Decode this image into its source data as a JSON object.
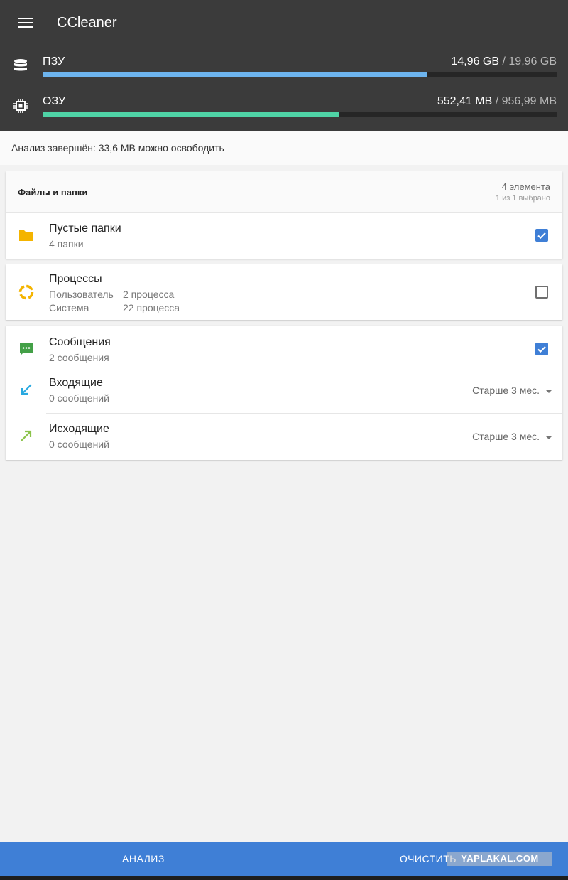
{
  "app": {
    "title": "CCleaner",
    "menu_icon": "hamburger-menu-icon"
  },
  "memory": {
    "rom": {
      "label": "ПЗУ",
      "used": "14,96 GB",
      "separator": "/",
      "total": "19,96 GB",
      "fraction": 0.749,
      "color": "#6db4ee",
      "icon": "database-icon"
    },
    "ram": {
      "label": "ОЗУ",
      "used": "552,41 MB",
      "separator": "/",
      "total": "956,99 MB",
      "fraction": 0.577,
      "color": "#4fd3a6",
      "icon": "chip-icon"
    }
  },
  "status": {
    "text": "Анализ завершён: 33,6 MB можно освободить"
  },
  "files_card": {
    "title": "Файлы и папки",
    "count": "4 элемента",
    "selected": "1 из 1 выбрано",
    "items": [
      {
        "title": "Пустые папки",
        "subtitle": "4 папки",
        "checked": true,
        "icon": "folder-icon",
        "icon_color": "#f4b400"
      }
    ]
  },
  "processes_card": {
    "title": "Процессы",
    "rows": [
      {
        "label": "Пользователь",
        "value": "2 процесса"
      },
      {
        "label": "Система",
        "value": "22 процесса"
      }
    ],
    "checked": false,
    "icon": "processes-ring-icon",
    "icon_color": "#f4b400"
  },
  "messages_card": {
    "title": "Сообщения",
    "subtitle": "2 сообщения",
    "checked": true,
    "icon": "message-icon",
    "icon_color": "#43a047",
    "items": [
      {
        "title": "Входящие",
        "subtitle": "0 сообщений",
        "filter": "Старше 3 мес.",
        "icon": "incoming-arrow-icon",
        "icon_color": "#29a9e0"
      },
      {
        "title": "Исходящие",
        "subtitle": "0 сообщений",
        "filter": "Старше 3 мес.",
        "icon": "outgoing-arrow-icon",
        "icon_color": "#8bc34a"
      }
    ]
  },
  "actions": {
    "analyze": "АНАЛИЗ",
    "clean": "ОЧИСТИТЬ"
  },
  "watermark": "YAPLAKAL.COM",
  "colors": {
    "header_bg": "#3b3b3b",
    "accent": "#3f7fd6",
    "page_bg": "#f2f2f2"
  }
}
